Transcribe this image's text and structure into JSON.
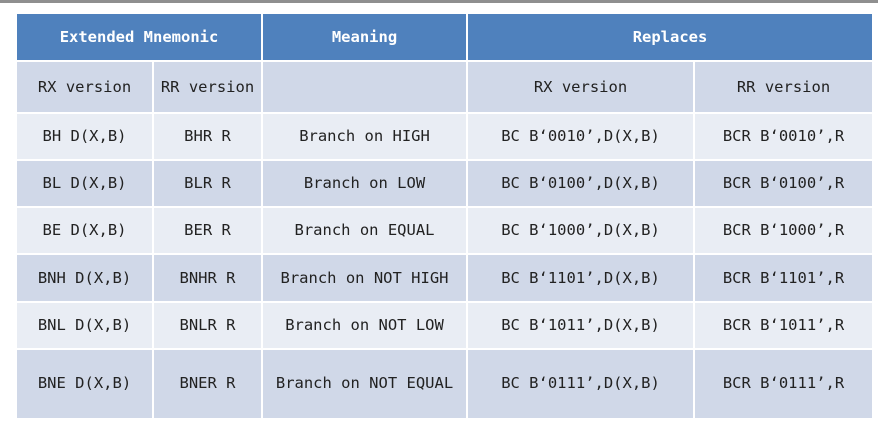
{
  "headers": {
    "extended": "Extended Mnemonic",
    "meaning": "Meaning",
    "replaces": "Replaces"
  },
  "subheaders": {
    "rx_version": "RX version",
    "rr_version": "RR version",
    "meaning_blank": "",
    "replaces_rx": "RX version",
    "replaces_rr": "RR version"
  },
  "rows": [
    {
      "rx": "BH D(X,B)",
      "rr": "BHR R",
      "meaning": "Branch on HIGH",
      "rep_rx": "BC B‘0010’,D(X,B)",
      "rep_rr": "BCR B‘0010’,R"
    },
    {
      "rx": "BL D(X,B)",
      "rr": "BLR R",
      "meaning": "Branch on LOW",
      "rep_rx": "BC B‘0100’,D(X,B)",
      "rep_rr": "BCR B‘0100’,R"
    },
    {
      "rx": "BE D(X,B)",
      "rr": "BER R",
      "meaning": "Branch on EQUAL",
      "rep_rx": "BC B‘1000’,D(X,B)",
      "rep_rr": "BCR B‘1000’,R"
    },
    {
      "rx": "BNH D(X,B)",
      "rr": "BNHR R",
      "meaning": "Branch on NOT HIGH",
      "rep_rx": "BC B‘1101’,D(X,B)",
      "rep_rr": "BCR B‘1101’,R"
    },
    {
      "rx": "BNL D(X,B)",
      "rr": "BNLR R",
      "meaning": "Branch on NOT LOW",
      "rep_rx": "BC B‘1011’,D(X,B)",
      "rep_rr": "BCR B‘1011’,R"
    },
    {
      "rx": "BNE D(X,B)",
      "rr": "BNER R",
      "meaning": "Branch on NOT EQUAL",
      "rep_rx": "BC B‘0111’,D(X,B)",
      "rep_rr": "BCR B‘0111’,R"
    }
  ],
  "colors": {
    "header_bg": "#4f81bd",
    "band_dark": "#d0d8e8",
    "band_light": "#e9edf4"
  }
}
